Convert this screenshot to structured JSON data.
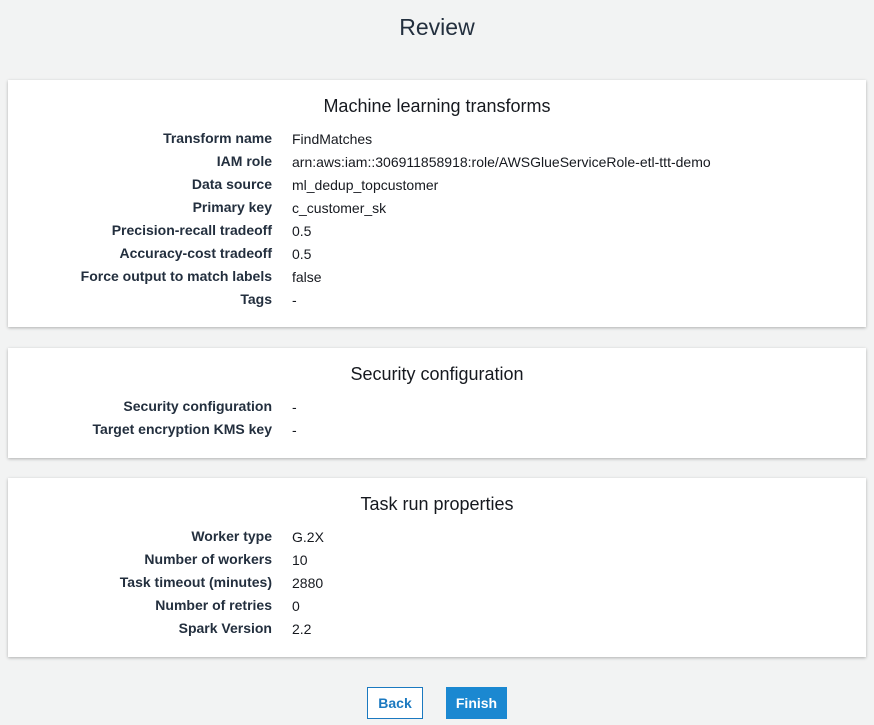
{
  "page": {
    "title": "Review"
  },
  "sections": [
    {
      "title": "Machine learning transforms",
      "rows": [
        {
          "label": "Transform name",
          "value": "FindMatches"
        },
        {
          "label": "IAM role",
          "value": "arn:aws:iam::306911858918:role/AWSGlueServiceRole-etl-ttt-demo"
        },
        {
          "label": "Data source",
          "value": "ml_dedup_topcustomer"
        },
        {
          "label": "Primary key",
          "value": "c_customer_sk"
        },
        {
          "label": "Precision-recall tradeoff",
          "value": "0.5"
        },
        {
          "label": "Accuracy-cost tradeoff",
          "value": "0.5"
        },
        {
          "label": "Force output to match labels",
          "value": "false"
        },
        {
          "label": "Tags",
          "value": "-"
        }
      ]
    },
    {
      "title": "Security configuration",
      "rows": [
        {
          "label": "Security configuration",
          "value": "-"
        },
        {
          "label": "Target encryption KMS key",
          "value": "-"
        }
      ]
    },
    {
      "title": "Task run properties",
      "rows": [
        {
          "label": "Worker type",
          "value": "G.2X"
        },
        {
          "label": "Number of workers",
          "value": "10"
        },
        {
          "label": "Task timeout (minutes)",
          "value": "2880"
        },
        {
          "label": "Number of retries",
          "value": "0"
        },
        {
          "label": "Spark Version",
          "value": "2.2"
        }
      ]
    }
  ],
  "actions": {
    "back_label": "Back",
    "finish_label": "Finish"
  },
  "colors": {
    "background": "#f2f3f3",
    "primary": "#1b88d1",
    "link": "#1b79c0"
  }
}
